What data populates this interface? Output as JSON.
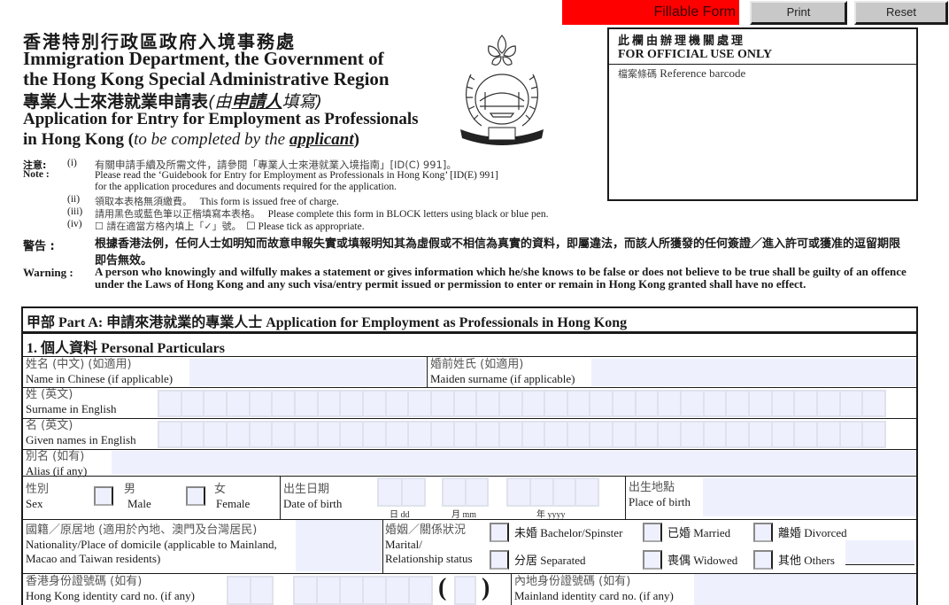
{
  "toolbar": {
    "badge": "Fillable Form",
    "print_label": "Print",
    "reset_label": "Reset",
    "badge_color": "#ff0000"
  },
  "header": {
    "dept_zh": "香港特別行政區政府入境事務處",
    "dept_en_line1": "Immigration Department, the Government of",
    "dept_en_line2": "the Hong Kong Special Administrative Region",
    "form_zh": "專業人士來港就業申請表",
    "form_zh_paren_open": "(由",
    "form_zh_applicant": "申請人",
    "form_zh_paren_close": "填寫)",
    "form_en_line1": "Application for Entry for Employment as Professionals",
    "form_en_line2_prefix": "in Hong Kong (",
    "form_en_line2_italic": "to be completed by the ",
    "form_en_line2_applicant": "applicant",
    "form_en_line2_suffix": ")",
    "emblem": "immigration-department-emblem"
  },
  "official_box": {
    "title_zh": "此欄由辦理機關處理",
    "title_en": "FOR OFFICIAL USE ONLY",
    "barcode_label_zh": "檔案條碼",
    "barcode_label_en": "Reference barcode"
  },
  "notes": {
    "label_zh": "注意:",
    "label_en": "Note :",
    "items": [
      {
        "num": "(i)",
        "zh": "有關申請手續及所需文件，請參閱「專業人士來港就業入境指南」[ID(C) 991]。",
        "en1": "Please read the ‘Guidebook for Entry for Employment as Professionals in Hong Kong’ [ID(E) 991]",
        "en2": "for the application procedures and documents required for the application."
      },
      {
        "num": "(ii)",
        "zh": "領取本表格無須繳費。",
        "en": "This form is issued free of charge."
      },
      {
        "num": "(iii)",
        "zh": "請用黑色或藍色筆以正楷填寫本表格。",
        "en": "Please complete this form in BLOCK letters using black or blue pen."
      },
      {
        "num": "(iv)",
        "zh": "☐ 請在適當方格內填上「✓」號。",
        "en": "☐ Please tick as appropriate."
      }
    ]
  },
  "warning": {
    "label_zh": "警告 :",
    "text_zh": "根據香港法例，任何人士如明知而故意申報失實或填報明知其為虛假或不相信為真實的資料，即屬違法，而該人所獲發的任何簽證／進入許可或獲准的逗留期限即告無效。",
    "label_en": "Warning :",
    "text_en": "A person who knowingly and wilfully makes a statement or gives information which he/she knows to be false or does not believe to be true shall be guilty of an offence under the Laws of Hong Kong and any such visa/entry permit issued or permission to enter or remain in Hong Kong granted shall have no effect."
  },
  "part_a": {
    "title": "甲部 Part A:  申請來港就業的專業人士  Application for Employment as Professionals in Hong Kong",
    "section1": "1.  個人資料  Personal Particulars",
    "fields": {
      "name_zh": {
        "zh": "姓名 (中文) (如適用)",
        "en": "Name in Chinese (if applicable)",
        "value": ""
      },
      "maiden": {
        "zh": "婚前姓氏 (如適用)",
        "en": "Maiden surname (if applicable)",
        "value": ""
      },
      "surname": {
        "zh": "姓 (英文)",
        "en": "Surname in English",
        "value": ""
      },
      "given": {
        "zh": "名 (英文)",
        "en": "Given names in English",
        "value": ""
      },
      "alias": {
        "zh": "別名 (如有)",
        "en": "Alias (if any)",
        "value": ""
      },
      "sex": {
        "zh": "性別",
        "en": "Sex",
        "male_zh": "男",
        "male_en": "Male",
        "female_zh": "女",
        "female_en": "Female"
      },
      "dob": {
        "zh": "出生日期",
        "en": "Date of birth",
        "dd": "日 dd",
        "mm": "月 mm",
        "yyyy": "年 yyyy"
      },
      "pob": {
        "zh": "出生地點",
        "en": "Place of birth",
        "value": ""
      },
      "nationality": {
        "zh": "國籍／原居地 (適用於內地、澳門及台灣居民)",
        "en1": "Nationality/Place of domicile (applicable to Mainland,",
        "en2": "Macao and Taiwan residents)",
        "value": ""
      },
      "marital": {
        "zh": "婚姻／關係狀況",
        "en1": "Marital/",
        "en2": "Relationship status",
        "options": [
          {
            "label": "未婚 Bachelor/Spinster"
          },
          {
            "label": "已婚 Married"
          },
          {
            "label": "離婚 Divorced"
          },
          {
            "label": "分居 Separated"
          },
          {
            "label": "喪偶 Widowed"
          },
          {
            "label": "其他 Others"
          }
        ]
      },
      "hkid": {
        "zh": "香港身份證號碼 (如有)",
        "en": "Hong Kong identity card no. (if any)",
        "paren_open": "(",
        "paren_close": ")"
      },
      "mainland_id": {
        "zh": "內地身份證號碼 (如有)",
        "en": "Mainland identity card no. (if any)",
        "value": ""
      }
    }
  }
}
